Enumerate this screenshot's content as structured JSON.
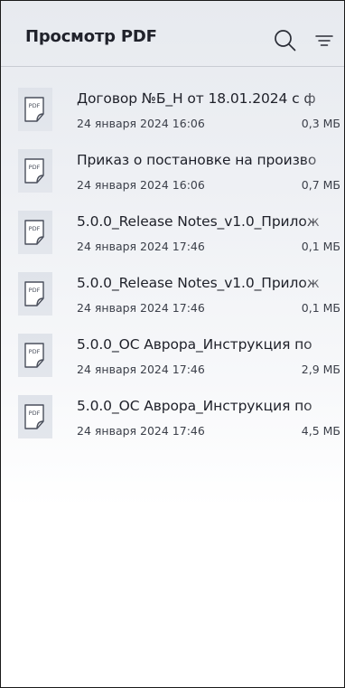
{
  "header": {
    "title": "Просмотр PDF",
    "search_icon": "search-icon",
    "sort_icon": "sort-icon"
  },
  "files": [
    {
      "name": "Договор №Б_Н от 18.01.2024 с ф",
      "date": "24 января 2024 16:06",
      "size": "0,3 МБ",
      "icon": "pdf-file-icon"
    },
    {
      "name": "Приказ о постановке на произво",
      "date": "24 января 2024 16:06",
      "size": "0,7 МБ",
      "icon": "pdf-file-icon"
    },
    {
      "name": "5.0.0_Release Notes_v1.0_Прилож",
      "date": "24 января 2024 17:46",
      "size": "0,1 МБ",
      "icon": "pdf-file-icon"
    },
    {
      "name": "5.0.0_Release Notes_v1.0_Прилож",
      "date": "24 января 2024 17:46",
      "size": "0,1 МБ",
      "icon": "pdf-file-icon"
    },
    {
      "name": "5.0.0_ОС Аврора_Инструкция по",
      "date": "24 января 2024 17:46",
      "size": "2,9 МБ",
      "icon": "pdf-file-icon"
    },
    {
      "name": "5.0.0_ОС Аврора_Инструкция по",
      "date": "24 января 2024 17:46",
      "size": "4,5 МБ",
      "icon": "pdf-file-icon"
    }
  ],
  "pdf_icon_label": "PDF",
  "colors": {
    "background": "#eef0f4",
    "text": "#1e2029",
    "secondary_text": "#3b3f49",
    "thumbnail": "#e0e4ea"
  }
}
